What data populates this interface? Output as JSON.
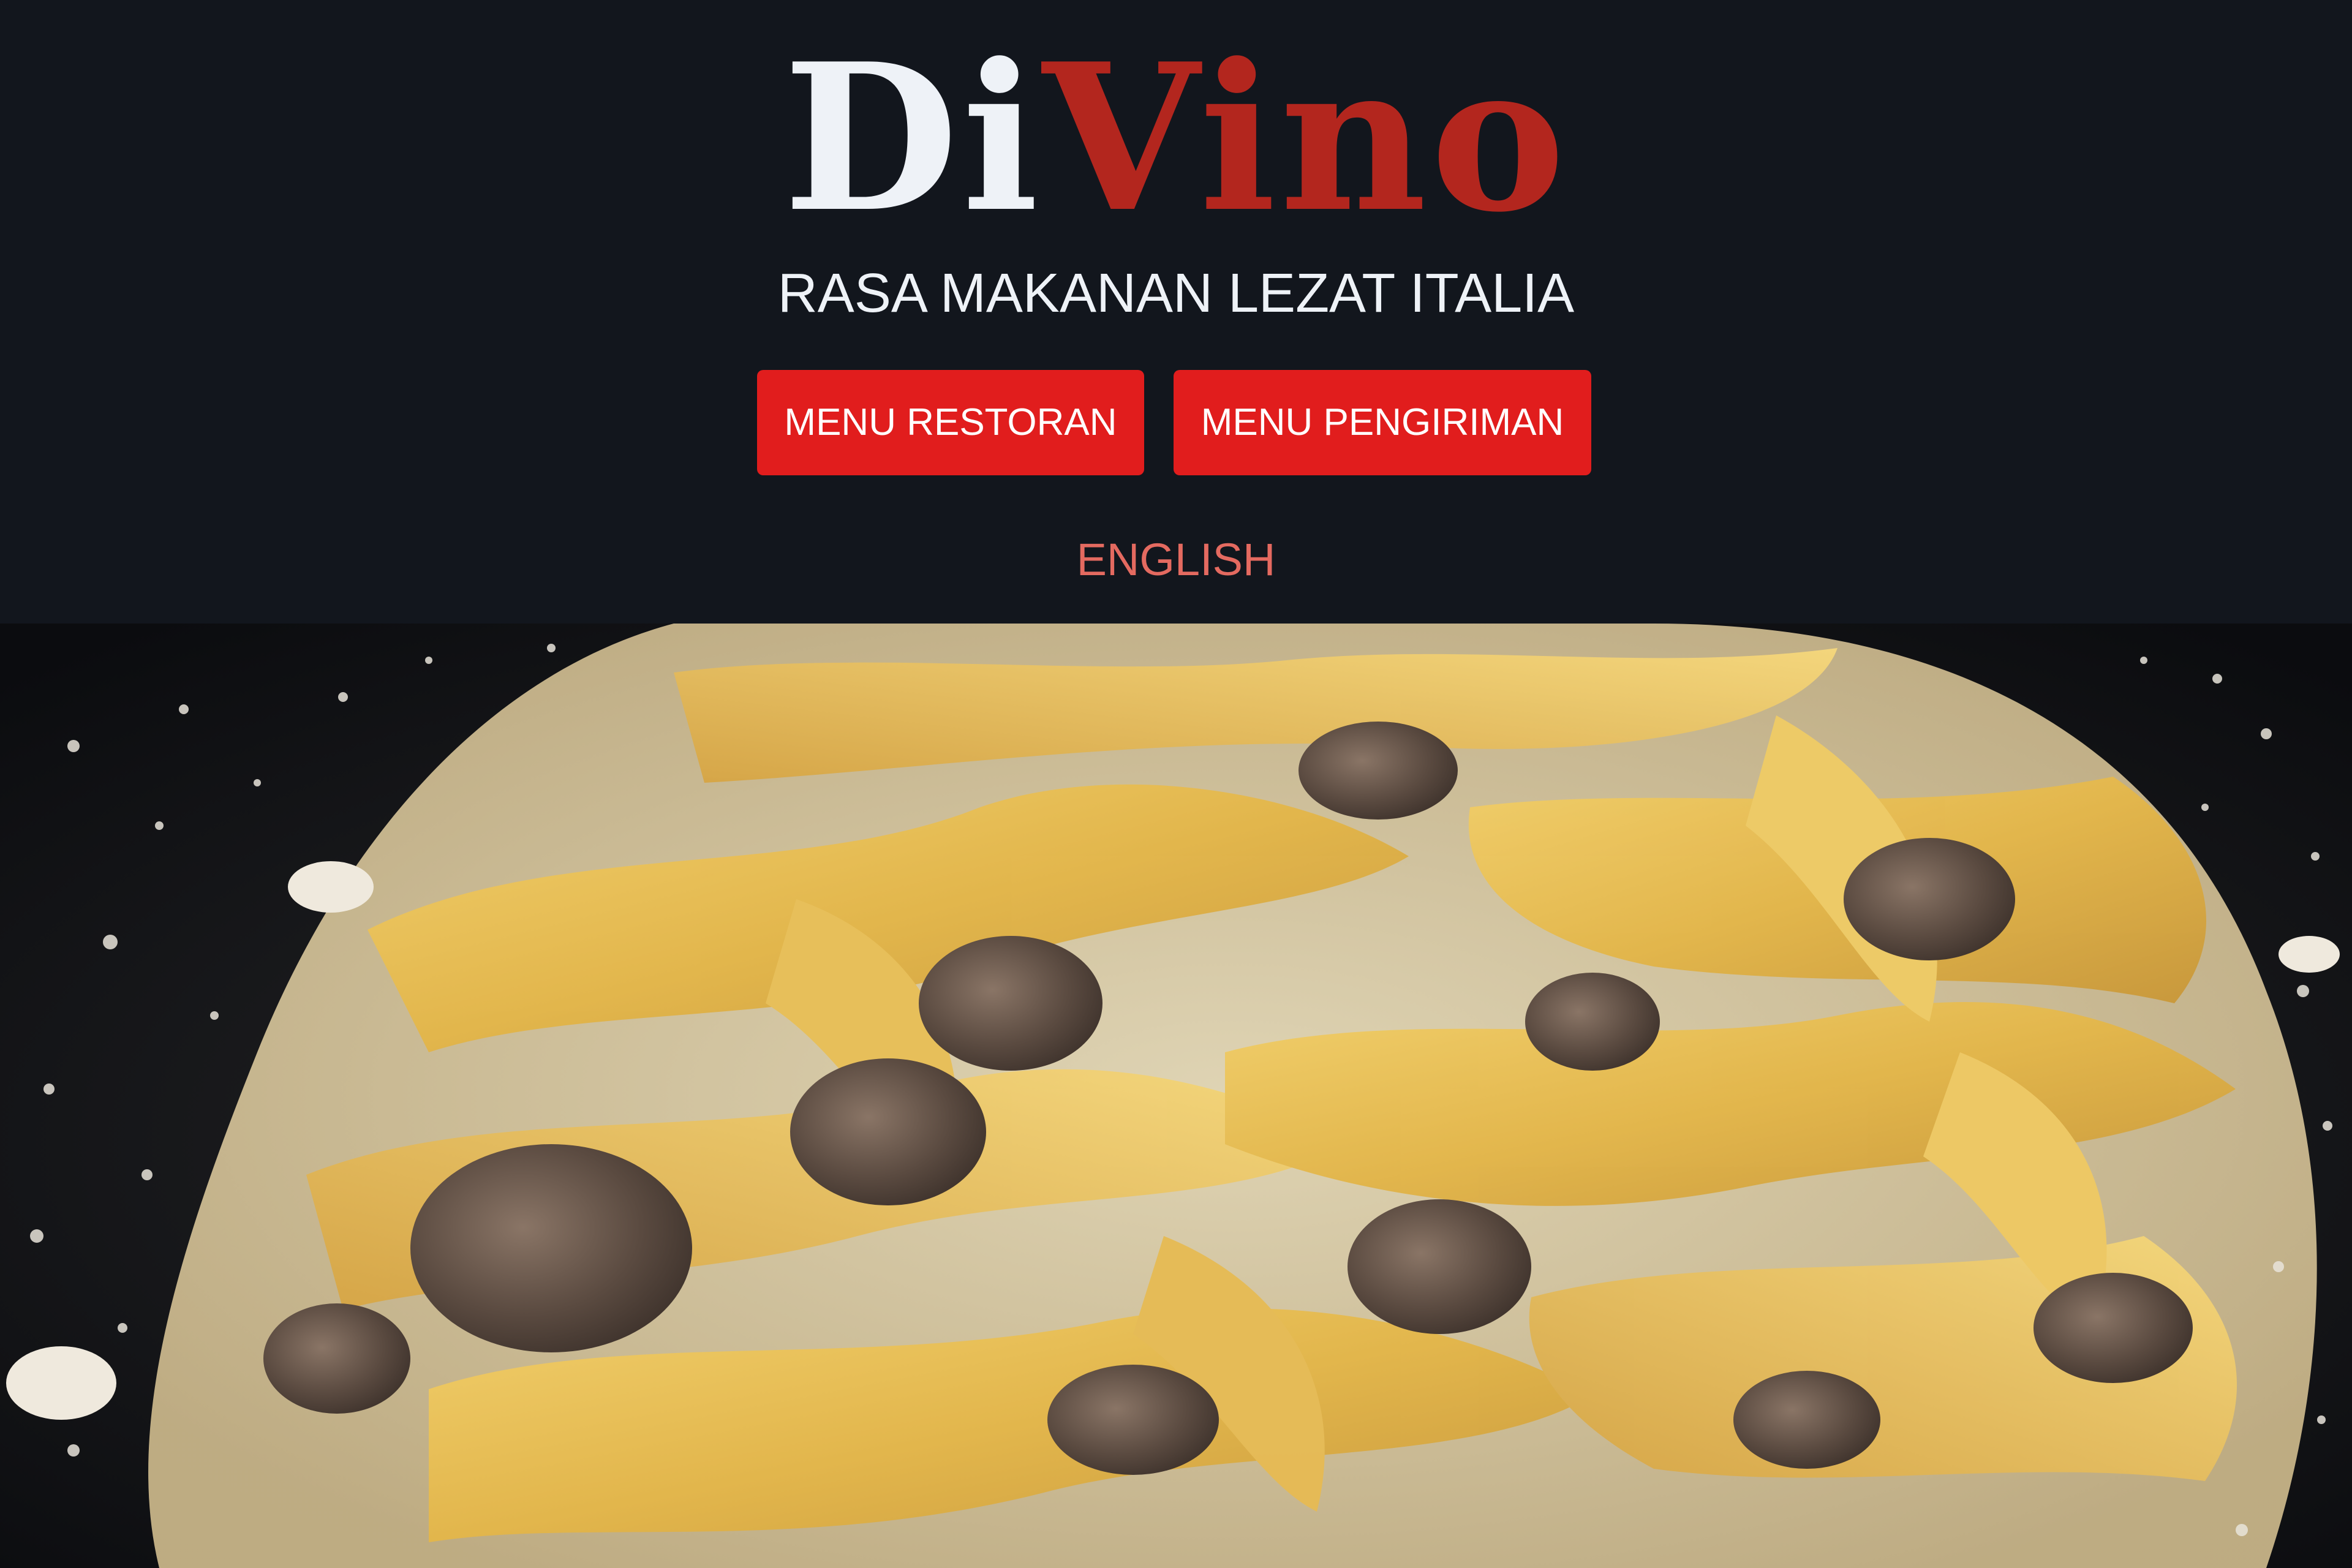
{
  "brand": {
    "logo_part1": "Di",
    "logo_part2": "Vino",
    "tagline": "RASA MAKANAN LEZAT ITALIA"
  },
  "nav": {
    "menu_restoran": "MENU RESTORAN",
    "menu_pengiriman": "MENU PENGIRIMAN",
    "language_link": "ENGLISH"
  },
  "hero": {
    "image_description": "plate of tagliatelle pasta with creamy mushroom sauce and grated cheese"
  },
  "colors": {
    "header_background": "#12161d",
    "button_red": "#e11d1d",
    "logo_red": "#b3261e",
    "logo_white": "#eef2f7",
    "link_coral": "#e46a60"
  }
}
